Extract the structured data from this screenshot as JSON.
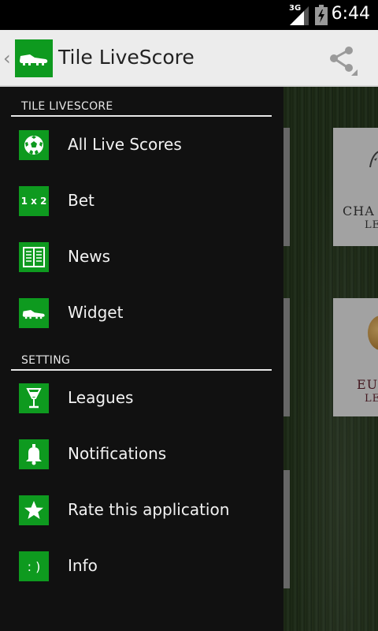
{
  "status_bar": {
    "network": "3G",
    "time": "6:44"
  },
  "action_bar": {
    "title": "Tile LiveScore",
    "app_icon": "football-boot-icon",
    "actions": [
      "share-icon"
    ]
  },
  "drawer": {
    "sections": [
      {
        "header": "TILE LIVESCORE",
        "items": [
          {
            "label": "All Live Scores",
            "icon": "soccer-ball-icon"
          },
          {
            "label": "Bet",
            "icon": "one-x-two-icon",
            "icon_text": "1 x 2"
          },
          {
            "label": "News",
            "icon": "newspaper-icon"
          },
          {
            "label": "Widget",
            "icon": "football-boot-icon"
          }
        ]
      },
      {
        "header": "SETTING",
        "items": [
          {
            "label": "Leagues",
            "icon": "trophy-cup-icon"
          },
          {
            "label": "Notifications",
            "icon": "bell-icon"
          },
          {
            "label": "Rate this application",
            "icon": "star-icon"
          },
          {
            "label": "Info",
            "icon": "smiley-icon",
            "icon_text": ": )"
          }
        ]
      }
    ]
  },
  "background": {
    "tiles": [
      {
        "line1": "CHA",
        "line2": "LE"
      },
      {
        "line1": "EU",
        "line2": "LE"
      }
    ]
  },
  "colors": {
    "accent_green": "#0e9a1f",
    "drawer_bg": "#111111",
    "action_bar_bg": "#ececec"
  }
}
